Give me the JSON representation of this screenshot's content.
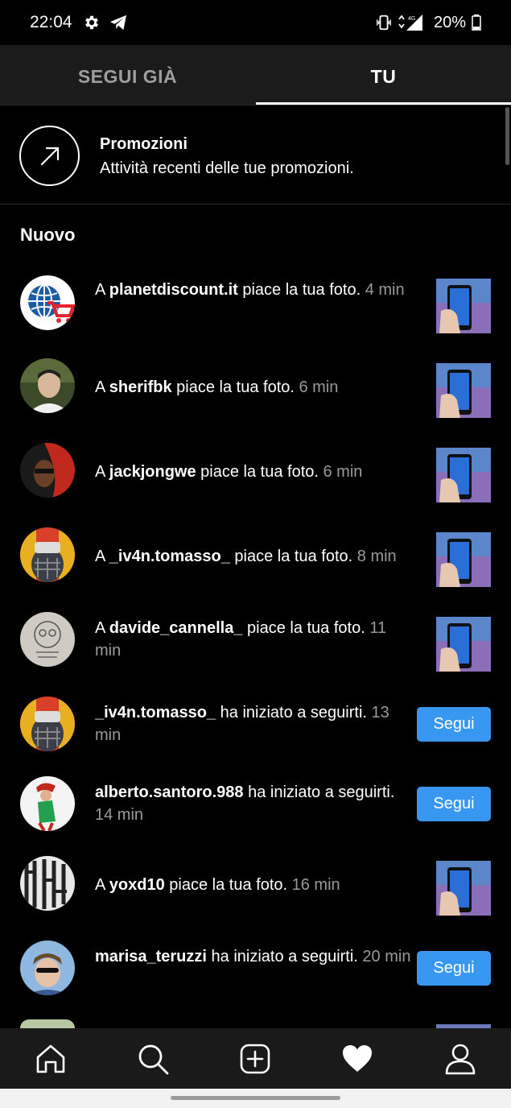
{
  "status_bar": {
    "time": "22:04",
    "battery": "20%",
    "network": "4G"
  },
  "tabs": [
    {
      "label": "SEGUI GIÀ",
      "active": false
    },
    {
      "label": "TU",
      "active": true
    }
  ],
  "promotions": {
    "title": "Promozioni",
    "subtitle": "Attività recenti delle tue promozioni."
  },
  "section_title": "Nuovo",
  "notifications": [
    {
      "prefix": "A ",
      "user": "planetdiscount.it",
      "action": " piace la tua foto. ",
      "time": "4 min",
      "kind": "like"
    },
    {
      "prefix": "A ",
      "user": "sherifbk",
      "action": " piace la tua foto. ",
      "time": "6 min",
      "kind": "like"
    },
    {
      "prefix": "A ",
      "user": "jackjongwe",
      "action": " piace la tua foto. ",
      "time": "6 min",
      "kind": "like"
    },
    {
      "prefix": "A ",
      "user": "_iv4n.tomasso_",
      "action": " piace la tua foto. ",
      "time": "8 min",
      "kind": "like"
    },
    {
      "prefix": "A ",
      "user": "davide_cannella_",
      "action": " piace la tua foto. ",
      "time": "11 min",
      "kind": "like"
    },
    {
      "prefix": "",
      "user": "_iv4n.tomasso_",
      "action": " ha iniziato a seguirti. ",
      "time": "13 min",
      "kind": "follow",
      "button": "Segui"
    },
    {
      "prefix": "",
      "user": "alberto.santoro.988",
      "action": " ha iniziato a seguirti. ",
      "time": "14 min",
      "kind": "follow",
      "button": "Segui"
    },
    {
      "prefix": "A ",
      "user": "yoxd10",
      "action": " piace la tua foto. ",
      "time": "16 min",
      "kind": "like"
    },
    {
      "prefix": "",
      "user": "marisa_teruzzi",
      "action": " ha iniziato a seguirti. ",
      "time": "20 min",
      "kind": "follow",
      "button": "Segui"
    }
  ],
  "bottom_nav": [
    {
      "icon": "home-icon"
    },
    {
      "icon": "search-icon"
    },
    {
      "icon": "add-post-icon"
    },
    {
      "icon": "heart-icon",
      "active": true
    },
    {
      "icon": "profile-icon"
    }
  ],
  "colors": {
    "follow_button": "#3897f0",
    "background": "#000000",
    "secondary_text": "#9a9a9a"
  }
}
